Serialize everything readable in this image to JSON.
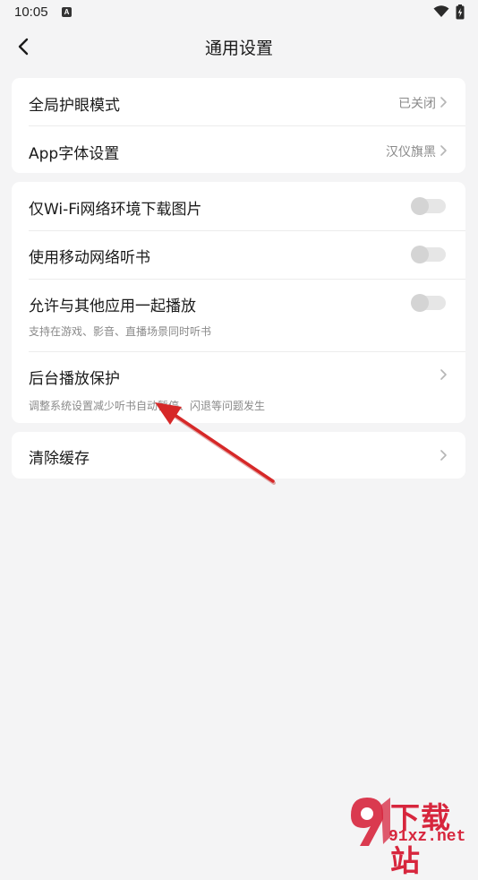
{
  "status_bar": {
    "time": "10:05",
    "notification_icon": "A"
  },
  "nav": {
    "title": "通用设置"
  },
  "group1": {
    "eye_mode": {
      "label": "全局护眼模式",
      "value": "已关闭"
    },
    "font": {
      "label": "App字体设置",
      "value": "汉仪旗黑"
    }
  },
  "group2": {
    "wifi_download": {
      "label": "仅Wi-Fi网络环境下载图片",
      "enabled": false
    },
    "mobile_listen": {
      "label": "使用移动网络听书",
      "enabled": false
    },
    "mix_play": {
      "label": "允许与其他应用一起播放",
      "sub": "支持在游戏、影音、直播场景同时听书",
      "enabled": false
    },
    "bg_protect": {
      "label": "后台播放保护",
      "sub": "调整系统设置减少听书自动暂停、闪退等问题发生"
    }
  },
  "group3": {
    "clear_cache": {
      "label": "清除缓存"
    }
  },
  "annotation": {
    "color": "#d62828"
  },
  "watermark": {
    "title": "下载站",
    "url": "91xz.net",
    "color": "#d7263d"
  }
}
